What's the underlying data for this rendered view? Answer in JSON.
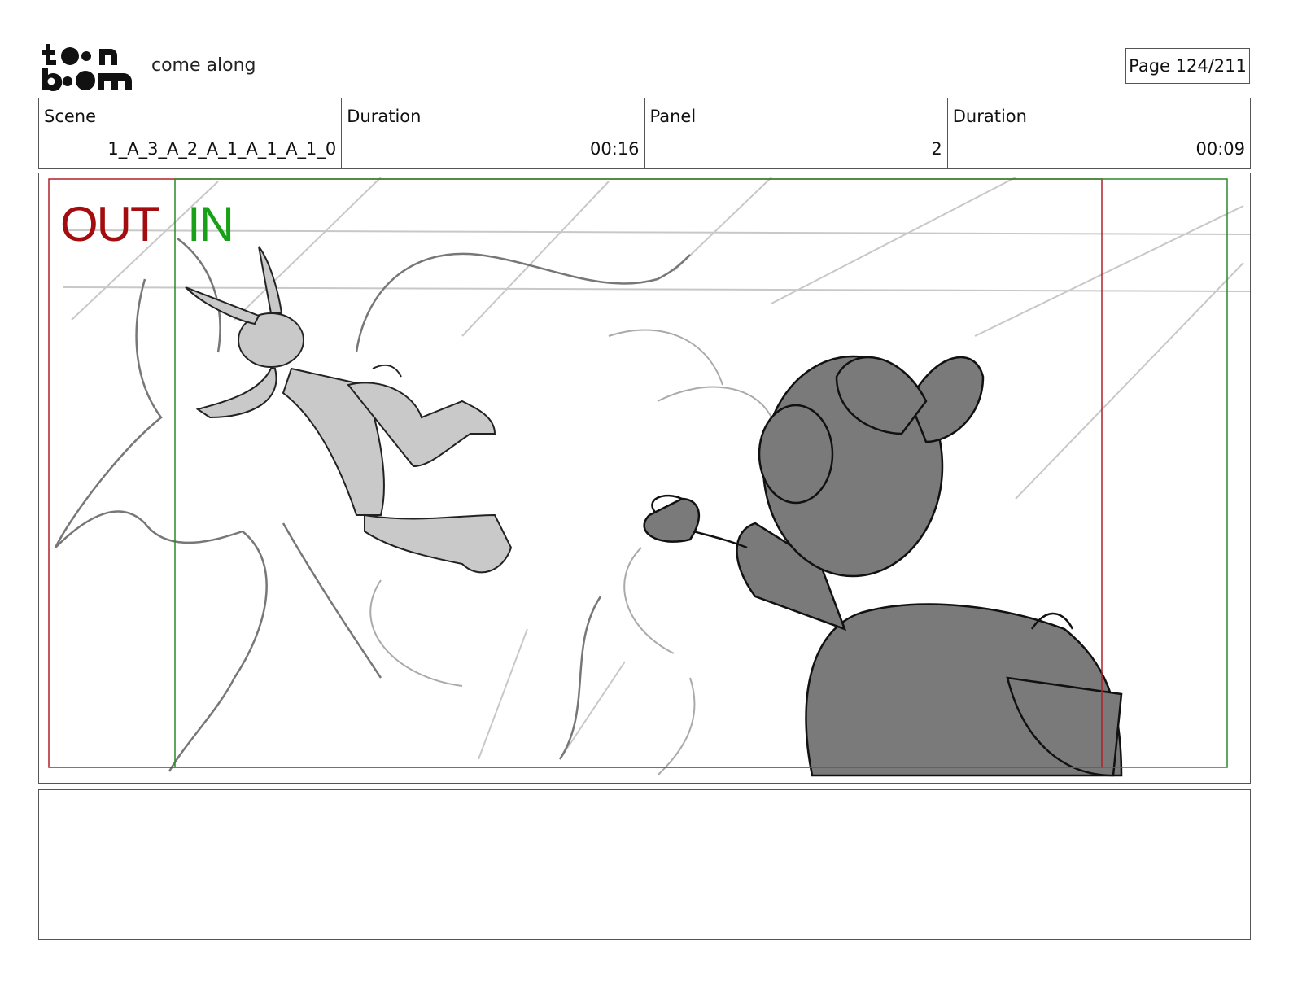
{
  "header": {
    "logo_text": "toon boom",
    "project_title": "come along",
    "page_label": "Page 124/211"
  },
  "info": {
    "scene_label": "Scene",
    "scene_value": "1_A_3_A_2_A_1_A_1_A_1_0",
    "scene_duration_label": "Duration",
    "scene_duration_value": "00:16",
    "panel_label": "Panel",
    "panel_value": "2",
    "panel_duration_label": "Duration",
    "panel_duration_value": "00:09"
  },
  "panel": {
    "out_label": "OUT",
    "in_label": "IN",
    "out_color": "#a30d10",
    "in_color": "#19a019"
  },
  "notes": {
    "text": ""
  }
}
